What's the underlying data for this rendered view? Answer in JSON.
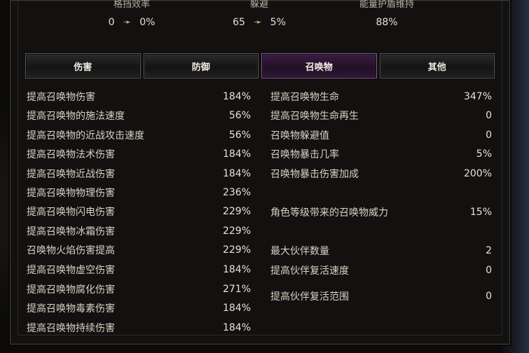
{
  "top_stats": [
    {
      "label": "格挡效率",
      "from": "0",
      "to": "0%"
    },
    {
      "label": "躲避",
      "from": "65",
      "to": "5%"
    },
    {
      "label": "能量护盾维持",
      "value": "88%"
    }
  ],
  "tabs": [
    "伤害",
    "防御",
    "召唤物",
    "其他"
  ],
  "active_tab": "召唤物",
  "left_stats": [
    {
      "label": "提高召唤物伤害",
      "value": "184%"
    },
    {
      "label": "提高召唤物的施法速度",
      "value": "56%"
    },
    {
      "label": "提高召唤物的近战攻击速度",
      "value": "56%"
    },
    {
      "label": "提高召唤物法术伤害",
      "value": "184%"
    },
    {
      "label": "提高召唤物近战伤害",
      "value": "184%"
    },
    {
      "label": "提高召唤物物理伤害",
      "value": "236%"
    },
    {
      "label": "提高召唤物闪电伤害",
      "value": "229%"
    },
    {
      "label": "提高召唤物冰霜伤害",
      "value": "229%"
    },
    {
      "label": "召唤物火焰伤害提高",
      "value": "229%"
    },
    {
      "label": "提高召唤物虚空伤害",
      "value": "184%"
    },
    {
      "label": "提高召唤物腐化伤害",
      "value": "271%"
    },
    {
      "label": "提高召唤物毒素伤害",
      "value": "184%"
    },
    {
      "label": "提高召唤物持续伤害",
      "value": "184%"
    }
  ],
  "right_stats": [
    {
      "label": "提高召唤物生命",
      "value": "347%"
    },
    {
      "label": "提高召唤物生命再生",
      "value": "0"
    },
    {
      "label": "召唤物躲避值",
      "value": "0"
    },
    {
      "label": "召唤物暴击几率",
      "value": "5%"
    },
    {
      "label": "召唤物暴击伤害加成",
      "value": "200%"
    },
    {
      "label": "角色等级带来的召唤物威力",
      "value": "15%"
    },
    {
      "label": "最大伙伴数量",
      "value": "2"
    },
    {
      "label": "提高伙伴复活速度",
      "value": "0"
    },
    {
      "label": "提高伙伴复活范围",
      "value": "0"
    }
  ]
}
